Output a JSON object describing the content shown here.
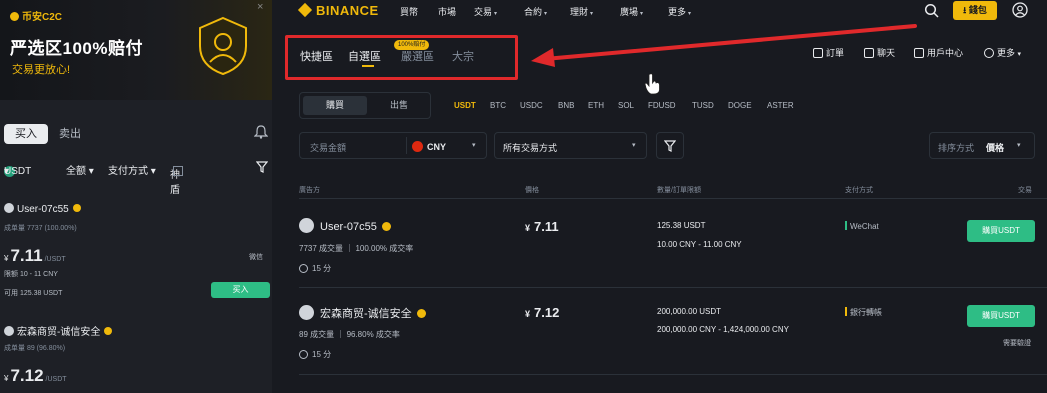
{
  "mobile": {
    "banner": {
      "brand": "币安C2C",
      "title": "严选区100%赔付",
      "subtitle": "交易更放心!",
      "close": "×"
    },
    "tabs": {
      "buy": "买入",
      "sell": "卖出"
    },
    "filters": {
      "coin": "USDT",
      "coin_caret": "▾",
      "amount": "全额 ▾",
      "payment": "支付方式 ▾",
      "verified": "神盾"
    },
    "ads": [
      {
        "user": "User-07c55",
        "stats": "成单量 7737 (100.00%)",
        "currency": "¥",
        "price": "7.11",
        "unit": "/USDT",
        "limit": "限额 10 - 11 CNY",
        "available": "可用 125.38 USDT",
        "pay": "微信",
        "buy": "买入"
      },
      {
        "user": "宏森商贸-诚信安全",
        "stats": "成单量 89 (96.80%)",
        "currency": "¥",
        "price": "7.12",
        "unit": "/USDT"
      }
    ]
  },
  "nav": {
    "logo": "BINANCE",
    "items": [
      "買幣",
      "市場",
      "交易",
      "合約",
      "理財",
      "廣場",
      "更多"
    ],
    "wallet": "錢包"
  },
  "page_tabs": {
    "items": [
      "快捷區",
      "自選區",
      "嚴選區",
      "大宗"
    ],
    "badge": "100%赔付"
  },
  "right_tools": [
    "訂單",
    "聊天",
    "用戶中心",
    "更多"
  ],
  "trade_toggle": {
    "buy": "購買",
    "sell": "出售"
  },
  "coins": [
    "USDT",
    "BTC",
    "USDC",
    "BNB",
    "ETH",
    "SOL",
    "FDUSD",
    "TUSD",
    "DOGE",
    "ASTER"
  ],
  "filters": {
    "amount_placeholder": "交易金額",
    "currency": "CNY",
    "payment": "所有交易方式",
    "sort_label": "排序方式",
    "sort_value": "價格"
  },
  "table": {
    "headers": [
      "廣告方",
      "價格",
      "數量/訂單限額",
      "支付方式",
      "交易"
    ],
    "rows": [
      {
        "user": "User-07c55",
        "stats": "7737 成交量 ｜ 100.00% 成交率",
        "time": "15 分",
        "currency": "¥",
        "price": "7.11",
        "quantity": "125.38 USDT",
        "limit": "10.00 CNY - 11.00 CNY",
        "payment": "WeChat",
        "action": "購買USDT"
      },
      {
        "user": "宏森商贸-诚信安全",
        "stats": "89 成交量 ｜ 96.80% 成交率",
        "time": "15 分",
        "currency": "¥",
        "price": "7.12",
        "quantity": "200,000.00 USDT",
        "limit": "200,000.00 CNY - 1,424,000.00 CNY",
        "payment": "銀行轉帳",
        "action": "購買USDT",
        "extra": "需要驗證"
      }
    ]
  },
  "colors": {
    "accent": "#f0b90b",
    "buy_green": "#2ebd85",
    "highlight_red": "#e0292b",
    "background": "#181a20"
  }
}
